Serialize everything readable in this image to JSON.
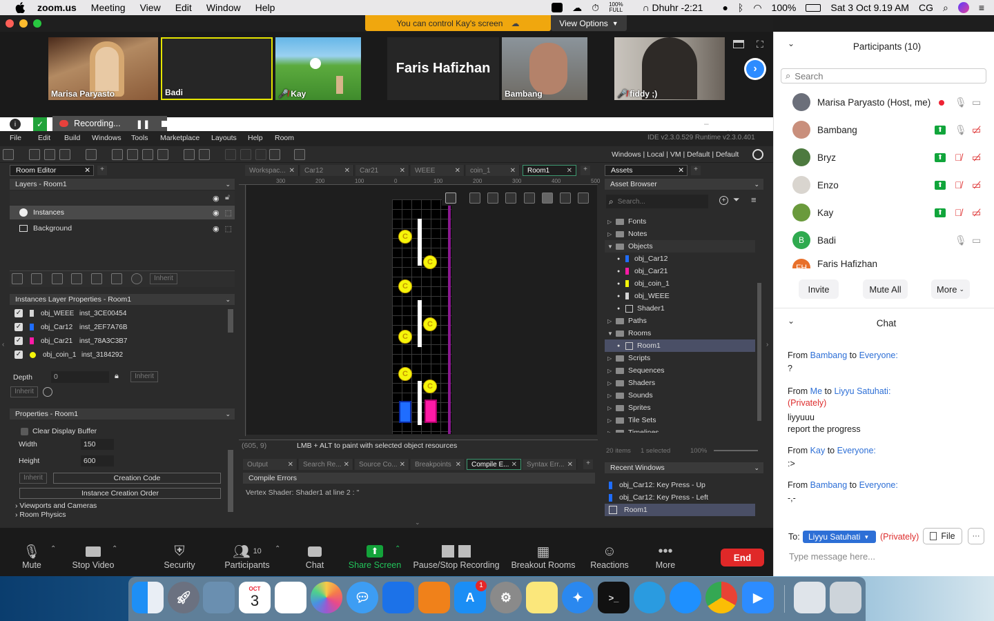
{
  "menubar": {
    "app": "zoom.us",
    "items": [
      "Meeting",
      "View",
      "Edit",
      "Window",
      "Help"
    ],
    "battery_small": "100%",
    "battery_full": "FULL",
    "prayer": "Dhuhr -2:21",
    "battery_pct": "100%",
    "datetime": "Sat 3 Oct  9.19 AM",
    "user_initials": "CG"
  },
  "banner": {
    "control": "You can control Kay's screen",
    "view_options": "View Options"
  },
  "tiles": [
    {
      "name": "Marisa Paryasto"
    },
    {
      "name": "Badi"
    },
    {
      "name": "Kay"
    },
    {
      "name": "Faris Hafizhan"
    },
    {
      "name": "Bambang"
    },
    {
      "name": "fiddy ;)"
    }
  ],
  "recording": {
    "label": "Recording..."
  },
  "gm": {
    "menu": [
      "File",
      "Edit",
      "Build",
      "Windows",
      "Tools",
      "Marketplace",
      "Layouts",
      "Help",
      "Room"
    ],
    "version": "IDE v2.3.0.529  Runtime v2.3.0.401",
    "targets": "Windows  |  Local  |  VM  |  Default  |  Default",
    "room_editor_tab": "Room Editor",
    "layers_title": "Layers - Room1",
    "layers": [
      "Instances",
      "Background"
    ],
    "inherit": "Inherit",
    "instances_title": "Instances Layer Properties - Room1",
    "instances": [
      {
        "obj": "obj_WEEE",
        "inst": "inst_3CE00454",
        "color": "#d4d4d4"
      },
      {
        "obj": "obj_Car12",
        "inst": "inst_2EF7A76B",
        "color": "#1f6dff"
      },
      {
        "obj": "obj_Car21",
        "inst": "inst_78A3C3B7",
        "color": "#ff1aa6"
      },
      {
        "obj": "obj_coin_1",
        "inst": "inst_3184292",
        "color": "#f5f50a"
      }
    ],
    "depth_label": "Depth",
    "depth_value": "0",
    "properties_title": "Properties - Room1",
    "clear_display": "Clear Display Buffer",
    "width_label": "Width",
    "width_value": "150",
    "height_label": "Height",
    "height_value": "600",
    "creation_code": "Creation Code",
    "instance_order": "Instance Creation Order",
    "viewports": "Viewports and Cameras",
    "physics": "Room Physics",
    "doc_tabs": [
      "Workspac...",
      "Car12",
      "Car21",
      "WEEE",
      "coin_1",
      "Room1"
    ],
    "ruler": [
      "300",
      "200",
      "100",
      "0",
      "100",
      "200",
      "300",
      "400",
      "500"
    ],
    "status_coords": "(605, 9)",
    "status_hint": "LMB + ALT to paint with selected object resources",
    "coin_letter": "C",
    "output_tabs": [
      "Output",
      "Search Re...",
      "Source Co...",
      "Breakpoints",
      "Compile E...",
      "Syntax Err..."
    ],
    "compile_errors": "Compile Errors",
    "error_line": "Vertex Shader: Shader1 at line 2 : ''",
    "assets_tab": "Assets",
    "asset_browser": "Asset Browser",
    "search_placeholder": "Search...",
    "tree": [
      {
        "label": "Fonts",
        "level": 0,
        "open": false
      },
      {
        "label": "Notes",
        "level": 0,
        "open": false
      },
      {
        "label": "Objects",
        "level": 0,
        "open": true
      },
      {
        "label": "obj_Car12",
        "level": 1,
        "color": "#1f6dff"
      },
      {
        "label": "obj_Car21",
        "level": 1,
        "color": "#ff1aa6"
      },
      {
        "label": "obj_coin_1",
        "level": 1,
        "color": "#f5f50a"
      },
      {
        "label": "obj_WEEE",
        "level": 1,
        "color": "#d4d4d4"
      },
      {
        "label": "Shader1",
        "level": 1
      },
      {
        "label": "Paths",
        "level": 0,
        "open": false
      },
      {
        "label": "Rooms",
        "level": 0,
        "open": true
      },
      {
        "label": "Room1",
        "level": 1,
        "selected": true
      },
      {
        "label": "Scripts",
        "level": 0,
        "open": false
      },
      {
        "label": "Sequences",
        "level": 0,
        "open": false
      },
      {
        "label": "Shaders",
        "level": 0,
        "open": false
      },
      {
        "label": "Sounds",
        "level": 0,
        "open": false
      },
      {
        "label": "Sprites",
        "level": 0,
        "open": false
      },
      {
        "label": "Tile Sets",
        "level": 0,
        "open": false
      },
      {
        "label": "Timelines",
        "level": 0,
        "open": false
      }
    ],
    "items_count": "20 items",
    "selected_count": "1 selected",
    "zoom_pct": "100%",
    "recent_title": "Recent Windows",
    "recent": [
      "obj_Car12: Key Press - Up",
      "obj_Car12: Key Press - Left",
      "Room1"
    ]
  },
  "toolbar": {
    "mute": "Mute",
    "stop_video": "Stop Video",
    "security": "Security",
    "participants": "Participants",
    "participants_count": "10",
    "chat": "Chat",
    "share": "Share Screen",
    "pause_rec": "Pause/Stop Recording",
    "breakout": "Breakout Rooms",
    "reactions": "Reactions",
    "more": "More",
    "end": "End"
  },
  "participants_panel": {
    "title": "Participants (10)",
    "search_placeholder": "Search",
    "list": [
      {
        "name": "Marisa Paryasto (Host, me)",
        "avatar_color": "#6b6f7a"
      },
      {
        "name": "Bambang",
        "avatar_color": "#c98f7c"
      },
      {
        "name": "Bryz",
        "avatar_color": "#4d7a3f"
      },
      {
        "name": "Enzo",
        "avatar_color": "#d9d5cf"
      },
      {
        "name": "Kay",
        "avatar_color": "#6a9a3c"
      },
      {
        "name": "Badi",
        "avatar_color": "#2faa4f",
        "initials": "B"
      },
      {
        "name": "Faris Hafizhan",
        "avatar_color": "#e8702a",
        "initials": "FH"
      }
    ],
    "invite": "Invite",
    "mute_all": "Mute All",
    "more": "More"
  },
  "chat": {
    "title": "Chat",
    "from": "From",
    "to": "to",
    "messages": [
      {
        "sender": "Bambang",
        "recipient": "Everyone:",
        "text": "?"
      },
      {
        "sender": "Me",
        "recipient": "Liyyu Satuhati:",
        "privately": "(Privately)",
        "text": "liyyuuu",
        "text2": "report the progress"
      },
      {
        "sender": "Kay",
        "recipient": "Everyone:",
        "text": ":>"
      },
      {
        "sender": "Bambang",
        "recipient": "Everyone:",
        "text": "-,-"
      }
    ],
    "to_label": "To:",
    "recipient": "Liyyu Satuhati",
    "privately": "(Privately)",
    "file": "File",
    "input_placeholder": "Type message here..."
  },
  "dock": {
    "calendar_month": "OCT",
    "calendar_day": "3",
    "appstore_badge": "1"
  }
}
